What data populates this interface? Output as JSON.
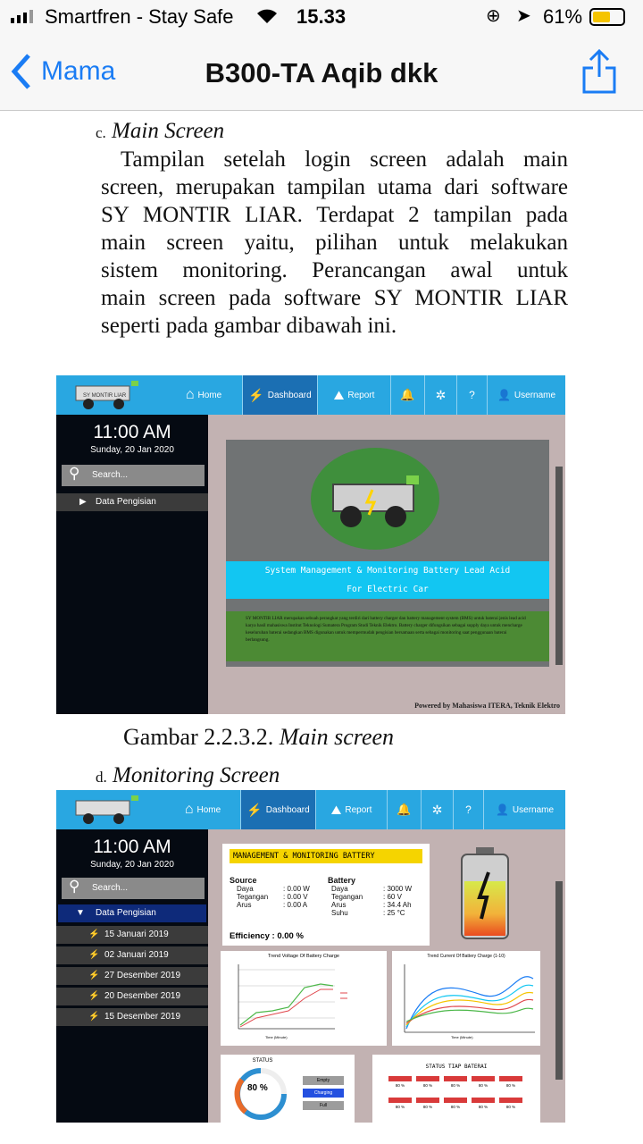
{
  "status": {
    "carrier": "Smartfren - Stay Safe",
    "time": "15.33",
    "battery": "61%"
  },
  "nav": {
    "back": "Mama",
    "title": "B300-TA Aqib dkk"
  },
  "doc": {
    "sec_c_letter": "c.",
    "sec_c_title": "Main Screen",
    "para_lines": [
      "Tampilan setelah login screen adalah main",
      "screen, merupakan tampilan utama dari software",
      "SY MONTIR LIAR. Terdapat 2 tampilan pada",
      "main screen yaitu, pilihan untuk melakukan",
      "sistem monitoring. Perancangan awal untuk",
      "main screen pada software SY MONTIR LIAR",
      "seperti pada gambar dibawah ini."
    ],
    "caption1": "Gambar 2.2.3.2.",
    "caption1_em": "Main screen",
    "sec_d_letter": "d.",
    "sec_d_title": "Monitoring Screen"
  },
  "app": {
    "logo_text": "SY MONTIR LIAR",
    "menu": [
      "Home",
      "Dashboard",
      "Report",
      "Username"
    ],
    "time": "11:00  AM",
    "date": "Sunday, 20 Jan 2020",
    "search": "Search...",
    "side_item": "Data Pengisian",
    "banner1": "System Management & Monitoring Battery Lead Acid",
    "banner2": "For Electric Car",
    "desc": "SY MONTIR LIAR merupakan sebuah perangkat yang terdiri dari battery charger dan battery management system (BMS) untuk baterai jenis lead acid karya hasil mahasiswa Institut Teknologi Sumatera Program Studi Teknik Elektro. Battery charger difungsikan sebagai supply daya untuk mencharge keseluruhan baterai sedangkan BMS digunakan untuk mempermudah pengisian bersamaan serta sebagai monitoring saat penggunaan baterai berlangsung.",
    "footer": "Powered by Mahasiswa ITERA, Teknik Elektro"
  },
  "mon": {
    "dates": [
      "15 Januari 2019",
      "02 Januari 2019",
      "27 Desember 2019",
      "20 Desember 2019",
      "15 Desember 2019"
    ],
    "panel_title": "MANAGEMENT & MONITORING BATTERY",
    "source_h": "Source",
    "battery_h": "Battery",
    "source": [
      [
        "Daya",
        ": 0.00 W"
      ],
      [
        "Tegangan",
        ": 0.00 V"
      ],
      [
        "Arus",
        ": 0.00 A"
      ]
    ],
    "battery": [
      [
        "Daya",
        ": 3000 W"
      ],
      [
        "Tegangan",
        ": 60 V"
      ],
      [
        "Arus",
        ": 34.4 Ah"
      ],
      [
        "Suhu",
        ": 25 °C"
      ]
    ],
    "eff_label": "Efficiency  :",
    "eff_value": "0.00 %",
    "chart1_title": "Trend Voltage Of Battery Charge",
    "chart2_title": "Trend Current Of Battery Charge (1-10)",
    "xlabel": "Time (Minute)",
    "status_title": "STATUS",
    "status_pct": "80 %",
    "status_btns": [
      "Empty",
      "Charging",
      "Full"
    ],
    "tiap_title": "STATUS TIAP BATERAI",
    "cell_pct": "80 %"
  },
  "colors": {
    "accent": "#29a7e1",
    "ios_blue": "#1a7cf4",
    "green": "#4c8a34",
    "cyan": "#12c6f2"
  }
}
